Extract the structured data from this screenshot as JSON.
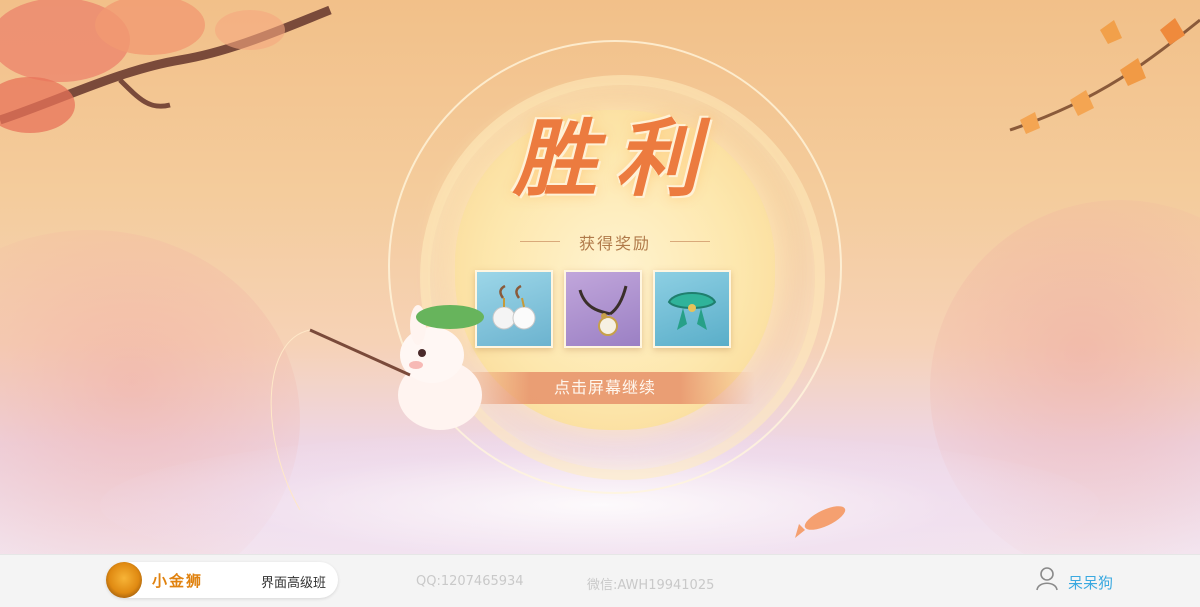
{
  "screen": {
    "title": "胜利",
    "subtitle": "获得奖励",
    "continue_label": "点击屏幕继续",
    "rewards": [
      {
        "icon": "pearl-earrings-icon",
        "color": "#8fcbe1"
      },
      {
        "icon": "pendant-necklace-icon",
        "color": "#b49ad4"
      },
      {
        "icon": "jade-ribbon-icon",
        "color": "#7ec4de"
      }
    ],
    "accent": "#ec7b3f"
  },
  "footer": {
    "brand_name": "小金狮",
    "brand_class": "界面高级班",
    "qq": "QQ:1207465934",
    "wechat": "微信:AWH19941025",
    "user_name": "呆呆狗",
    "user_icon": "user-icon"
  }
}
